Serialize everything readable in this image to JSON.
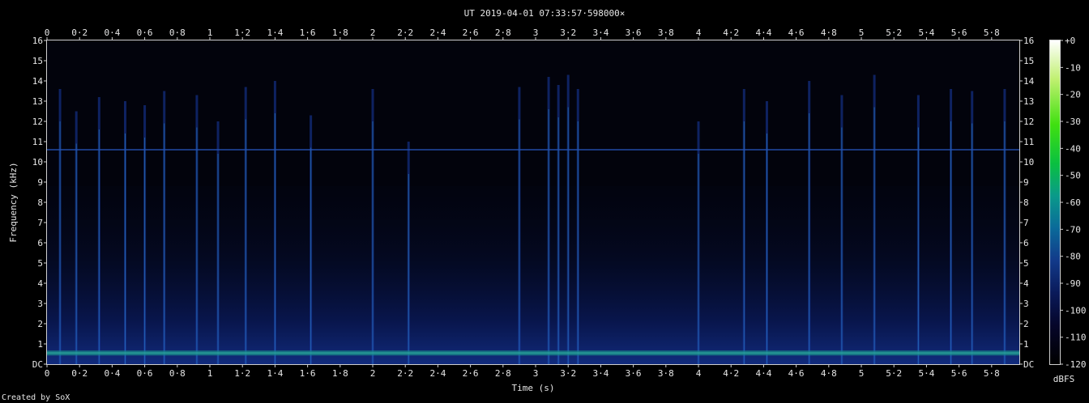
{
  "chart_data": {
    "type": "heatmap",
    "title": "UT 2019-04-01 07:33:57·598000×",
    "xlabel": "Time (s)",
    "ylabel": "Frequency (kHz)",
    "xlim": [
      0,
      5.97
    ],
    "ylim": [
      0,
      16
    ],
    "x_ticks": [
      {
        "v": 0,
        "label": "0"
      },
      {
        "v": 0.2,
        "label": "0·2"
      },
      {
        "v": 0.4,
        "label": "0·4"
      },
      {
        "v": 0.6,
        "label": "0·6"
      },
      {
        "v": 0.8,
        "label": "0·8"
      },
      {
        "v": 1,
        "label": "1"
      },
      {
        "v": 1.2,
        "label": "1·2"
      },
      {
        "v": 1.4,
        "label": "1·4"
      },
      {
        "v": 1.6,
        "label": "1·6"
      },
      {
        "v": 1.8,
        "label": "1·8"
      },
      {
        "v": 2,
        "label": "2"
      },
      {
        "v": 2.2,
        "label": "2·2"
      },
      {
        "v": 2.4,
        "label": "2·4"
      },
      {
        "v": 2.6,
        "label": "2·6"
      },
      {
        "v": 2.8,
        "label": "2·8"
      },
      {
        "v": 3,
        "label": "3"
      },
      {
        "v": 3.2,
        "label": "3·2"
      },
      {
        "v": 3.4,
        "label": "3·4"
      },
      {
        "v": 3.6,
        "label": "3·6"
      },
      {
        "v": 3.8,
        "label": "3·8"
      },
      {
        "v": 4,
        "label": "4"
      },
      {
        "v": 4.2,
        "label": "4·2"
      },
      {
        "v": 4.4,
        "label": "4·4"
      },
      {
        "v": 4.6,
        "label": "4·6"
      },
      {
        "v": 4.8,
        "label": "4·8"
      },
      {
        "v": 5,
        "label": "5"
      },
      {
        "v": 5.2,
        "label": "5·2"
      },
      {
        "v": 5.4,
        "label": "5·4"
      },
      {
        "v": 5.6,
        "label": "5·6"
      },
      {
        "v": 5.8,
        "label": "5·8"
      }
    ],
    "y_ticks": [
      {
        "v": 0,
        "label": "DC"
      },
      {
        "v": 1,
        "label": "1"
      },
      {
        "v": 2,
        "label": "2"
      },
      {
        "v": 3,
        "label": "3"
      },
      {
        "v": 4,
        "label": "4"
      },
      {
        "v": 5,
        "label": "5"
      },
      {
        "v": 6,
        "label": "6"
      },
      {
        "v": 7,
        "label": "7"
      },
      {
        "v": 8,
        "label": "8"
      },
      {
        "v": 9,
        "label": "9"
      },
      {
        "v": 10,
        "label": "10"
      },
      {
        "v": 11,
        "label": "11"
      },
      {
        "v": 12,
        "label": "12"
      },
      {
        "v": 13,
        "label": "13"
      },
      {
        "v": 14,
        "label": "14"
      },
      {
        "v": 15,
        "label": "15"
      },
      {
        "v": 16,
        "label": "16"
      }
    ],
    "colorbar": {
      "label": "dBFS",
      "range": [
        -120,
        0
      ],
      "ticks": [
        {
          "v": 0,
          "label": "+0"
        },
        {
          "v": -10,
          "label": "-10"
        },
        {
          "v": -20,
          "label": "-20"
        },
        {
          "v": -30,
          "label": "-30"
        },
        {
          "v": -40,
          "label": "-40"
        },
        {
          "v": -50,
          "label": "-50"
        },
        {
          "v": -60,
          "label": "-60"
        },
        {
          "v": -70,
          "label": "-70"
        },
        {
          "v": -80,
          "label": "-80"
        },
        {
          "v": -90,
          "label": "-90"
        },
        {
          "v": -100,
          "label": "-100"
        },
        {
          "v": -110,
          "label": "-110"
        },
        {
          "v": -120,
          "label": "-120"
        }
      ],
      "colors": [
        "#000000",
        "#06062a",
        "#0a1a5a",
        "#123a8a",
        "#0a6a9a",
        "#0a9a8a",
        "#0ac040",
        "#40e010",
        "#c0f070",
        "#ffffff"
      ]
    },
    "features": {
      "hum_band_khz": 0.55,
      "carrier_khz": 10.6,
      "impulses": [
        {
          "t": 0.08,
          "top": 13.6
        },
        {
          "t": 0.18,
          "top": 12.5
        },
        {
          "t": 0.32,
          "top": 13.2
        },
        {
          "t": 0.48,
          "top": 13.0
        },
        {
          "t": 0.6,
          "top": 12.8
        },
        {
          "t": 0.72,
          "top": 13.5
        },
        {
          "t": 0.92,
          "top": 13.3
        },
        {
          "t": 1.05,
          "top": 12.0
        },
        {
          "t": 1.22,
          "top": 13.7
        },
        {
          "t": 1.4,
          "top": 14.0
        },
        {
          "t": 1.62,
          "top": 12.3
        },
        {
          "t": 2.0,
          "top": 13.6
        },
        {
          "t": 2.22,
          "top": 11.0
        },
        {
          "t": 2.9,
          "top": 13.7
        },
        {
          "t": 3.08,
          "top": 14.2
        },
        {
          "t": 3.14,
          "top": 13.8
        },
        {
          "t": 3.2,
          "top": 14.3
        },
        {
          "t": 3.26,
          "top": 13.6
        },
        {
          "t": 4.0,
          "top": 12.0
        },
        {
          "t": 4.28,
          "top": 13.6
        },
        {
          "t": 4.42,
          "top": 13.0
        },
        {
          "t": 4.68,
          "top": 14.0
        },
        {
          "t": 4.88,
          "top": 13.3
        },
        {
          "t": 5.08,
          "top": 14.3
        },
        {
          "t": 5.35,
          "top": 13.3
        },
        {
          "t": 5.55,
          "top": 13.6
        },
        {
          "t": 5.68,
          "top": 13.5
        },
        {
          "t": 5.88,
          "top": 13.6
        }
      ]
    }
  },
  "footer": {
    "credit": "Created by SoX"
  }
}
